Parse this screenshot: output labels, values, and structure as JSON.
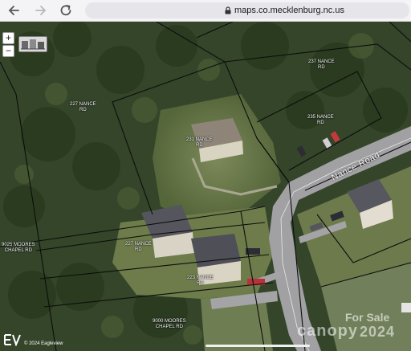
{
  "browser": {
    "url": "maps.co.mecklenburg.nc.us",
    "back_icon": "arrow-left-icon",
    "forward_icon": "arrow-right-icon",
    "reload_icon": "reload-icon",
    "lock_icon": "lock-icon"
  },
  "map": {
    "zoom_in": "+",
    "zoom_out": "−",
    "layer_icon": "layers-icon",
    "road_name": "Nance Road",
    "parcels": [
      "237 NANCE\nRD",
      "227 NANCE\nRD",
      "231 NANCE\nRD",
      "235 NANCE\nRD",
      "9025 MOORES\nCHAPEL RD",
      "227 NANCE\nRD",
      "223 NANCE\nRD",
      "9000 MOORES\nCHAPEL RD"
    ],
    "watermark": "canopy",
    "watermark_sale": "For Sale",
    "watermark_year": "2024",
    "copyright": "© 2024 Eagleview",
    "logo_icon": "ev-logo-icon"
  },
  "colors": {
    "parcel_line": "#111111",
    "road": "#9c9ca0",
    "forest": "#2f3f20"
  }
}
